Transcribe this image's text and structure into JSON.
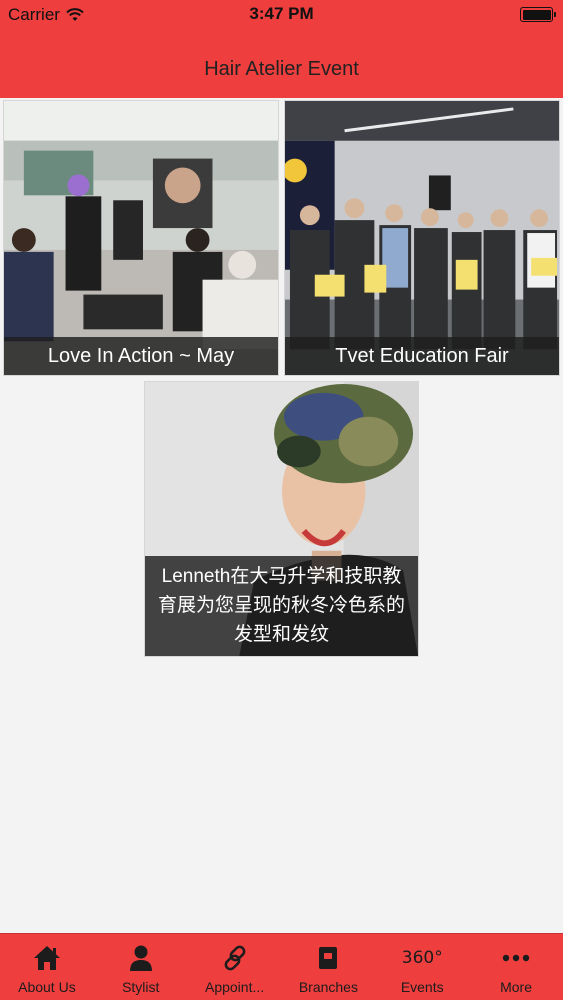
{
  "status_bar": {
    "carrier": "Carrier",
    "time": "3:47 PM"
  },
  "nav": {
    "title": "Hair Atelier Event"
  },
  "events": [
    {
      "caption": "Love In Action ~ May"
    },
    {
      "caption": "Tvet Education Fair"
    },
    {
      "caption": "Lenneth在大马升学和技职教育展为您呈现的秋冬冷色系的发型和发纹"
    }
  ],
  "tabbar": {
    "items": [
      {
        "label": "About Us",
        "icon": "home-icon"
      },
      {
        "label": "Stylist",
        "icon": "person-icon"
      },
      {
        "label": "Appoint...",
        "icon": "link-icon"
      },
      {
        "label": "Branches",
        "icon": "book-icon"
      },
      {
        "label": "Events",
        "icon": "360-icon",
        "icon_text": "360°"
      },
      {
        "label": "More",
        "icon": "more-icon"
      }
    ]
  },
  "colors": {
    "accent": "#ee3e3e",
    "background": "#f4f3f3",
    "caption_bg": "#1e1e1e"
  }
}
